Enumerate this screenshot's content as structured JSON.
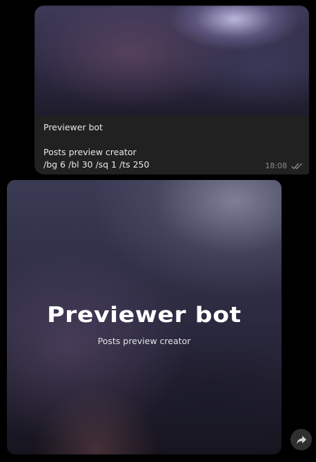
{
  "message": {
    "title": "Previewer bot",
    "line1": "Posts preview creator",
    "line2": "/bg 6 /bl 30 /sq 1 /ts 250",
    "time": "18:08",
    "status_icon": "double-check-icon"
  },
  "preview": {
    "title": "Previewer bot",
    "subtitle": "Posts preview creator"
  },
  "actions": {
    "share_icon": "share-arrow-icon"
  },
  "colors": {
    "background": "#000000",
    "bubble": "#212121",
    "meta_text": "#8b8b8b",
    "share_button": "#2f2f2f"
  }
}
